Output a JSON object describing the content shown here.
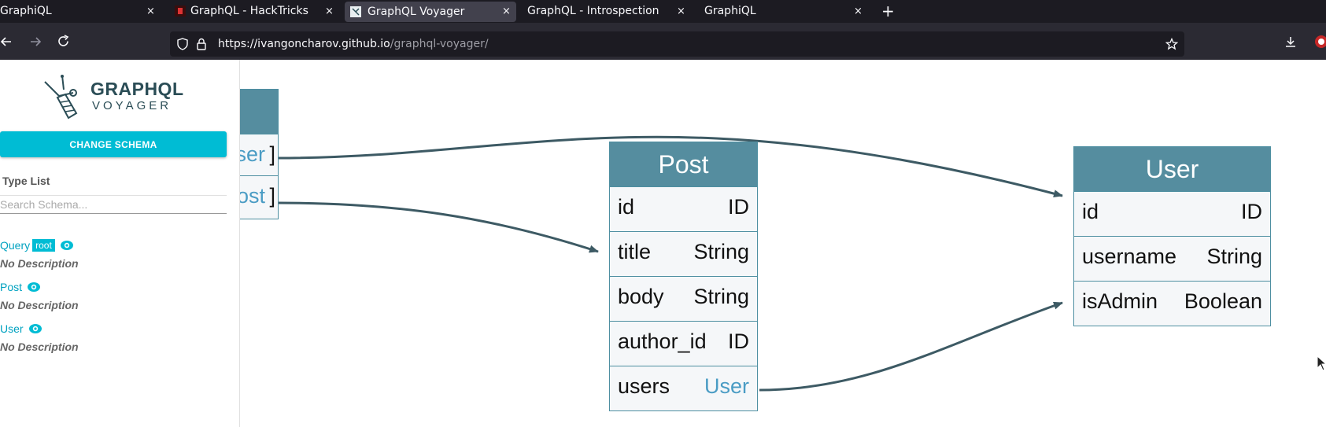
{
  "browser": {
    "tabs": [
      {
        "title": "GraphiQL",
        "active": false
      },
      {
        "title": "GraphQL - HackTricks",
        "active": false
      },
      {
        "title": "GraphQL Voyager",
        "active": true
      },
      {
        "title": "GraphQL - Introspection",
        "active": false
      },
      {
        "title": "GraphiQL",
        "active": false
      }
    ],
    "close_glyph": "×",
    "new_tab_glyph": "+",
    "url_host": "https://ivangoncharov.github.io",
    "url_path": "/graphql-voyager/",
    "icons": [
      "back-icon",
      "forward-icon",
      "reload-icon",
      "shield-icon",
      "lock-icon",
      "star-icon",
      "download-icon",
      "extension-icon"
    ]
  },
  "sidebar": {
    "logo_line1": "GRAPHQL",
    "logo_line2": "VOYAGER",
    "change_schema_label": "CHANGE SCHEMA",
    "type_list_label": "Type List",
    "search_placeholder": "Search Schema...",
    "types": [
      {
        "name": "Query",
        "badge": "root",
        "description": "No Description"
      },
      {
        "name": "Post",
        "badge": "",
        "description": "No Description"
      },
      {
        "name": "User",
        "badge": "",
        "description": "No Description"
      }
    ]
  },
  "graph": {
    "query_node": {
      "fields": [
        {
          "visible_type": "ser",
          "suffix": "]"
        },
        {
          "visible_type": "ost",
          "suffix": "]"
        }
      ]
    },
    "post_node": {
      "title": "Post",
      "fields": [
        {
          "name": "id",
          "type": "ID",
          "link": false
        },
        {
          "name": "title",
          "type": "String",
          "link": false
        },
        {
          "name": "body",
          "type": "String",
          "link": false
        },
        {
          "name": "author_id",
          "type": "ID",
          "link": false
        },
        {
          "name": "users",
          "type": "User",
          "link": true
        }
      ]
    },
    "user_node": {
      "title": "User",
      "fields": [
        {
          "name": "id",
          "type": "ID",
          "link": false
        },
        {
          "name": "username",
          "type": "String",
          "link": false
        },
        {
          "name": "isAdmin",
          "type": "Boolean",
          "link": false
        }
      ]
    }
  },
  "colors": {
    "accent": "#00bcd4",
    "node_header": "#558d9f",
    "edge": "#3d5a64",
    "link_type": "#4a9cc4"
  }
}
